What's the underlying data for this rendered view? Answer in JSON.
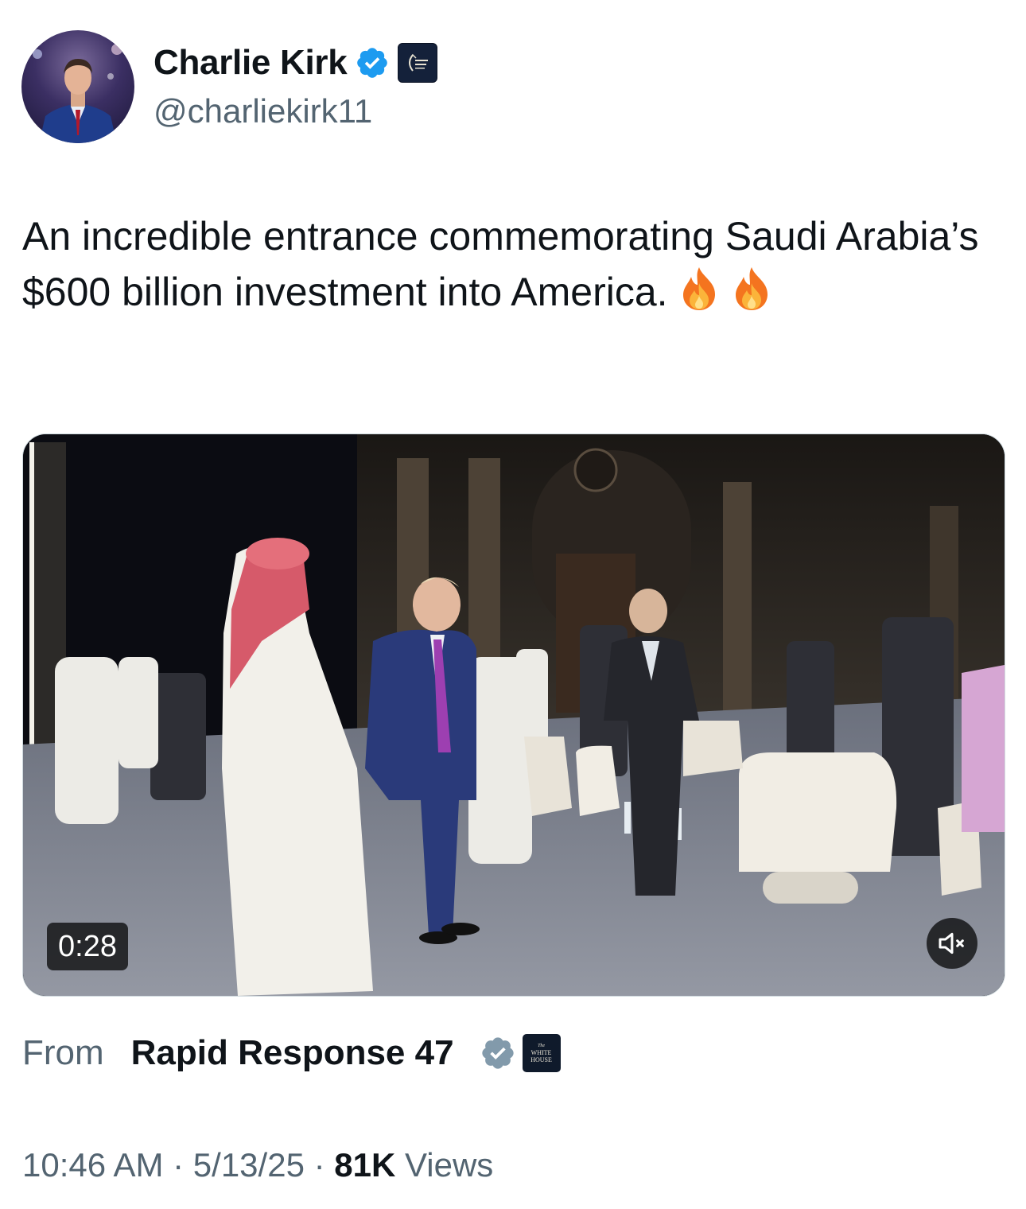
{
  "author": {
    "display_name": "Charlie Kirk",
    "handle": "@charliekirk11",
    "verified_color": "#1d9bf0",
    "affiliation_badge": "turning-point-usa-logo",
    "avatar": "profile-photo"
  },
  "tweet": {
    "text": "An incredible entrance commemorating Saudi Arabia’s $600 billion investment into America.",
    "emojis": [
      "fire-emoji",
      "fire-emoji"
    ]
  },
  "media": {
    "type": "video",
    "duration": "0:28",
    "mute_icon": "speaker-muted-icon"
  },
  "attribution": {
    "from_label": "From",
    "source_name": "Rapid Response 47",
    "verified_color": "#829aab",
    "badge_lines": [
      "The",
      "WHITE",
      "HOUSE"
    ]
  },
  "meta": {
    "time": "10:46 AM",
    "separator": " · ",
    "date": "5/13/25",
    "views_count": "81K",
    "views_label": "Views"
  },
  "colors": {
    "text_primary": "#0f1419",
    "text_secondary": "#536471",
    "verified_blue": "#1d9bf0",
    "verified_gray": "#829aab"
  }
}
